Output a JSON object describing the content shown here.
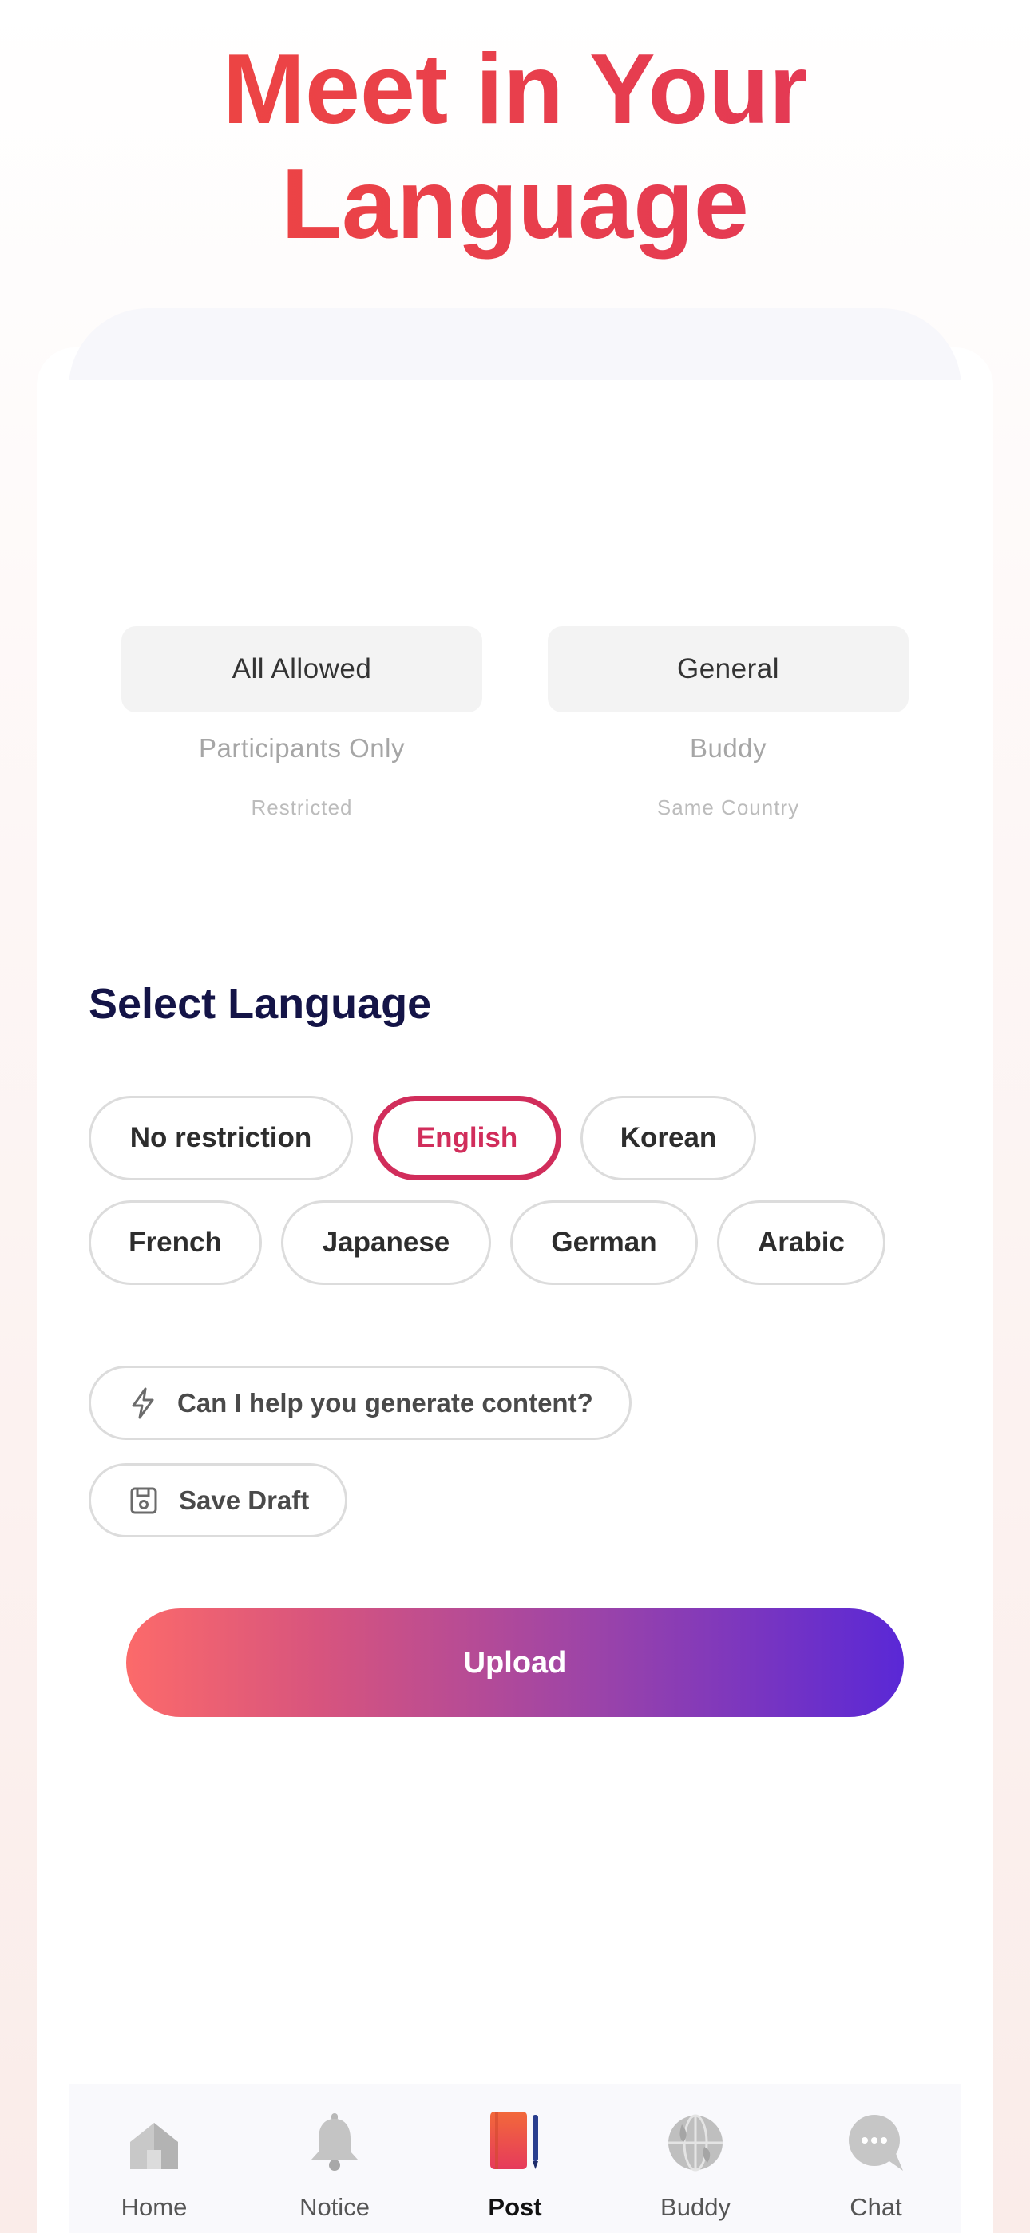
{
  "headline": {
    "line1": "Meet in Your",
    "line2": "Language"
  },
  "pickers": {
    "left": {
      "selected": "All Allowed",
      "options": [
        "Participants Only",
        "Restricted"
      ]
    },
    "right": {
      "selected": "General",
      "options": [
        "Buddy",
        "Same Country"
      ]
    }
  },
  "language": {
    "title": "Select Language",
    "options": [
      "No restriction",
      "English",
      "Korean",
      "French",
      "Japanese",
      "German",
      "Arabic"
    ],
    "selected": "English"
  },
  "actions": {
    "generate": {
      "label": "Can I help you generate content?",
      "icon": "lightning-icon"
    },
    "draft": {
      "label": "Save Draft",
      "icon": "floppy-disk-icon"
    }
  },
  "upload_label": "Upload",
  "tabbar": {
    "items": [
      {
        "label": "Home",
        "icon": "home-icon"
      },
      {
        "label": "Notice",
        "icon": "bell-icon"
      },
      {
        "label": "Post",
        "icon": "notebook-icon"
      },
      {
        "label": "Buddy",
        "icon": "globe-icon"
      },
      {
        "label": "Chat",
        "icon": "chat-bubble-icon"
      }
    ],
    "active": "Post"
  },
  "colors": {
    "headline": "#e84a4a",
    "accent": "#d12d5b",
    "title": "#141447",
    "upload_gradient_start": "#fc6a6a",
    "upload_gradient_end": "#5a28d6"
  }
}
